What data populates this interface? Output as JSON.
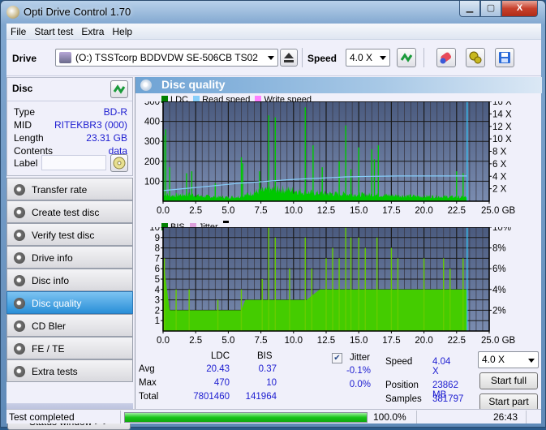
{
  "window": {
    "title": "Opti Drive Control 1.70",
    "controls": {
      "minimize": "▁",
      "maximize": "▢",
      "close": "X"
    }
  },
  "menu": [
    "File",
    "Start test",
    "Extra",
    "Help"
  ],
  "toolbar": {
    "drive_label": "Drive",
    "drive_value": "(O:)  TSSTcorp BDDVDW SE-506CB TS02",
    "speed_label": "Speed",
    "speed_value": "4.0 X",
    "icons": [
      "drive-icon",
      "eject-icon",
      "refresh-icon",
      "eraser-icon",
      "settings-icon",
      "save-icon"
    ]
  },
  "disc": {
    "header": "Disc",
    "rows": [
      {
        "key": "Type",
        "value": "BD-R"
      },
      {
        "key": "MID",
        "value": "RITEKBR3 (000)"
      },
      {
        "key": "Length",
        "value": "23.31 GB"
      },
      {
        "key": "Contents",
        "value": "data"
      }
    ],
    "label_key": "Label",
    "label_value": ""
  },
  "nav": [
    {
      "label": "Transfer rate",
      "active": false
    },
    {
      "label": "Create test disc",
      "active": false
    },
    {
      "label": "Verify test disc",
      "active": false
    },
    {
      "label": "Drive info",
      "active": false
    },
    {
      "label": "Disc info",
      "active": false
    },
    {
      "label": "Disc quality",
      "active": true
    },
    {
      "label": "CD Bler",
      "active": false
    },
    {
      "label": "FE / TE",
      "active": false
    },
    {
      "label": "Extra tests",
      "active": false
    }
  ],
  "status_window_button": "Status window > >",
  "panel": {
    "title": "Disc quality"
  },
  "chart_data": [
    {
      "type": "area",
      "title": "LDC",
      "legend": [
        {
          "name": "LDC",
          "color": "#008000"
        },
        {
          "name": "Read speed",
          "color": "#87cefa"
        },
        {
          "name": "Write speed",
          "color": "#ff80ff"
        }
      ],
      "legend_position": "top-left",
      "xlabel": "GB",
      "xlim": [
        0,
        25
      ],
      "x_ticks": [
        "0.0",
        "2.5",
        "5.0",
        "7.5",
        "10.0",
        "12.5",
        "15.0",
        "17.5",
        "20.0",
        "22.5",
        "25.0 GB"
      ],
      "ylim_left": [
        0,
        500
      ],
      "y_ticks_left": [
        "500",
        "400",
        "300",
        "200",
        "100"
      ],
      "ylim_right": [
        0,
        16
      ],
      "y_ticks_right": [
        "16 X",
        "14 X",
        "12 X",
        "10 X",
        "8 X",
        "6 X",
        "4 X",
        "2 X"
      ],
      "grid": true,
      "end_marker_x": 23.31,
      "series": [
        {
          "name": "LDC baseline",
          "x": [
            0,
            0.5,
            1,
            2,
            3,
            4,
            5,
            6,
            6.5,
            7,
            8,
            9,
            10,
            11,
            12,
            13,
            14,
            15,
            16,
            17,
            18,
            19,
            20,
            21,
            22,
            23,
            23.31
          ],
          "values": [
            40,
            28,
            30,
            35,
            25,
            22,
            20,
            24,
            35,
            45,
            55,
            60,
            55,
            45,
            40,
            38,
            36,
            34,
            32,
            30,
            28,
            26,
            24,
            24,
            22,
            20,
            20
          ]
        },
        {
          "name": "LDC spikes",
          "x": [
            0.05,
            0.2,
            0.5,
            1.8,
            2.2,
            4.0,
            6.0,
            6.1,
            7.4,
            8.1,
            8.6,
            10.9,
            11.5,
            12.2,
            13.5,
            14.0,
            14.4,
            15.0,
            16.0,
            16.2,
            16.5,
            22.5,
            23.0
          ],
          "values": [
            330,
            360,
            170,
            140,
            150,
            90,
            220,
            190,
            150,
            430,
            420,
            470,
            280,
            170,
            200,
            380,
            160,
            270,
            260,
            210,
            280,
            150,
            140
          ]
        },
        {
          "name": "Read speed",
          "x": [
            0,
            1,
            2,
            3,
            4,
            5,
            6,
            7,
            8,
            9,
            10,
            11,
            12,
            13,
            14,
            15,
            16,
            17,
            18,
            19,
            20,
            21,
            22,
            23,
            23.31
          ],
          "values": [
            1.7,
            1.9,
            2.1,
            2.3,
            2.5,
            2.7,
            2.9,
            3.05,
            3.2,
            3.35,
            3.5,
            3.6,
            3.7,
            3.8,
            3.9,
            3.95,
            4.0,
            4.02,
            4.04,
            4.04,
            4.04,
            4.04,
            4.04,
            4.04,
            4.04
          ]
        }
      ]
    },
    {
      "type": "area",
      "title": "BIS",
      "legend": [
        {
          "name": "BIS",
          "color": "#008000"
        },
        {
          "name": "Jitter",
          "color": "#dda0dd"
        }
      ],
      "legend_position": "top-left",
      "xlabel": "GB",
      "xlim": [
        0,
        25
      ],
      "x_ticks": [
        "0.0",
        "2.5",
        "5.0",
        "7.5",
        "10.0",
        "12.5",
        "15.0",
        "17.5",
        "20.0",
        "22.5",
        "25.0 GB"
      ],
      "ylim_left": [
        0,
        10
      ],
      "y_ticks_left": [
        "10",
        "9",
        "8",
        "7",
        "6",
        "5",
        "4",
        "3",
        "2",
        "1"
      ],
      "ylim_right": [
        0,
        10
      ],
      "y_ticks_right": [
        "10%",
        "8%",
        "6%",
        "4%",
        "2%"
      ],
      "grid": true,
      "end_marker_x": 23.31,
      "series": [
        {
          "name": "BIS baseline",
          "x": [
            0,
            0.5,
            1,
            2,
            3,
            4,
            5,
            6,
            6.3,
            7,
            8,
            9,
            10,
            11,
            12,
            13,
            14,
            15,
            16,
            17,
            18,
            19,
            20,
            21,
            22,
            23,
            23.31
          ],
          "values": [
            7,
            2,
            2,
            2,
            2,
            2,
            2,
            2,
            3,
            3,
            3,
            3,
            3,
            3,
            4,
            4,
            4,
            4,
            4,
            4,
            4,
            4,
            4,
            4,
            4,
            4,
            4
          ]
        },
        {
          "name": "BIS spikes",
          "x": [
            0.1,
            1.0,
            2.0,
            4.2,
            6.0,
            7.6,
            8.1,
            8.6,
            9.7,
            10.9,
            11.4,
            12.5,
            13.0,
            13.5,
            14.0,
            14.4,
            15.0,
            15.5,
            16.4,
            17.5,
            18.0,
            20.0,
            21.5,
            22.0,
            23.0
          ],
          "values": [
            7,
            4,
            4,
            3,
            4,
            5,
            10,
            9,
            6,
            9,
            6,
            7,
            8,
            7,
            10,
            9,
            9,
            8,
            9,
            8,
            7,
            7,
            7,
            6,
            7
          ]
        }
      ]
    }
  ],
  "stats": {
    "col_ldc": "LDC",
    "col_bis": "BIS",
    "rows": [
      {
        "label": "Avg",
        "ldc": "20.43",
        "bis": "0.37",
        "jitter": "-0.1%"
      },
      {
        "label": "Max",
        "ldc": "470",
        "bis": "10",
        "jitter": "0.0%"
      },
      {
        "label": "Total",
        "ldc": "7801460",
        "bis": "141964"
      }
    ],
    "jitter_label": "Jitter",
    "jitter_checked": true,
    "speed_label": "Speed",
    "speed_value": "4.04 X",
    "position_label": "Position",
    "position_value": "23862 MB",
    "samples_label": "Samples",
    "samples_value": "381797",
    "speed_select": "4.0 X",
    "start_full": "Start full",
    "start_part": "Start part"
  },
  "statusbar": {
    "text": "Test completed",
    "progress_percent": 100,
    "progress_label": "100.0%",
    "time": "26:43"
  },
  "colors": {
    "plot_bg_top": "#4a5a7e",
    "plot_bg_bottom": "#7a8cb0",
    "ldc_green": "#00c800",
    "bis_green": "#44cc00",
    "read_speed": "#87cefa",
    "marker": "#33ccff",
    "value_blue": "#1c1cd0",
    "nav_active": "#2a8fd8"
  }
}
